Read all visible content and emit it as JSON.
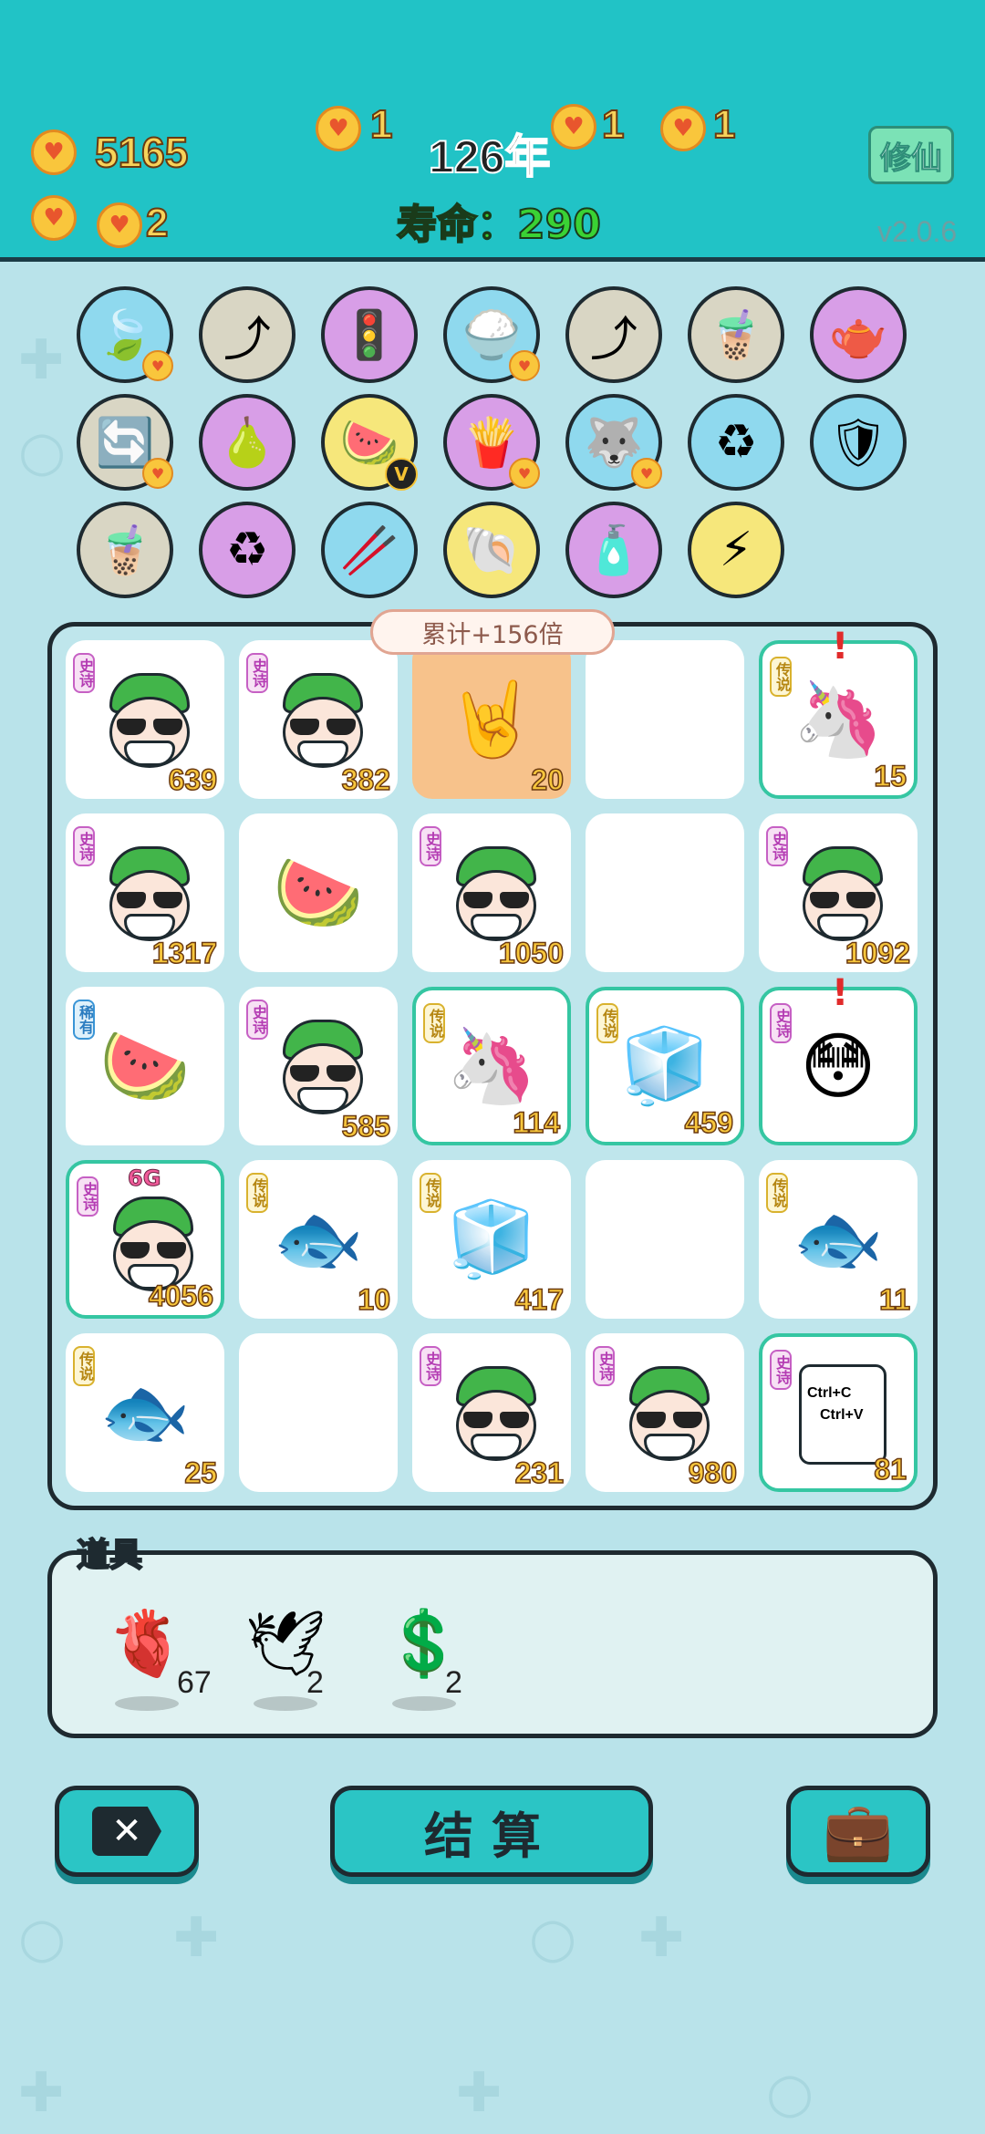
{
  "header": {
    "coins_total": "5165",
    "coin_small_a": "1",
    "coin_small_b": "1",
    "coin_small_c": "1",
    "coin_row2": "2",
    "year": "126年",
    "lifespan": "寿命：290",
    "cultivate_button": "修仙",
    "version": "v2.0.6"
  },
  "skills": [
    {
      "icon": "leaf-icon",
      "glyph": "🍃",
      "bg": "#8fd9ee",
      "badge": true
    },
    {
      "icon": "arrow-up-icon",
      "glyph": "⤴",
      "bg": "#d9d6c4",
      "badge": false
    },
    {
      "icon": "traffic-light-icon",
      "glyph": "🚦",
      "bg": "#d89ee7",
      "badge": false
    },
    {
      "icon": "rice-bowl-icon",
      "glyph": "🍚",
      "bg": "#8fd9ee",
      "badge": true
    },
    {
      "icon": "arrow-up-icon",
      "glyph": "⤴",
      "bg": "#d9d6c4",
      "badge": false
    },
    {
      "icon": "bubble-tea-icon",
      "glyph": "🧋",
      "bg": "#d9d6c4",
      "badge": false
    },
    {
      "icon": "gravy-boat-icon",
      "glyph": "🫖",
      "bg": "#d89ee7",
      "badge": false
    },
    {
      "icon": "refresh-icon",
      "glyph": "🔄",
      "bg": "#d9d6c4",
      "badge": true
    },
    {
      "icon": "grapefruit-icon",
      "glyph": "🍐",
      "bg": "#d89ee7",
      "badge": false
    },
    {
      "icon": "fruit-basket-icon",
      "glyph": "🍉",
      "bg": "#f6e77b",
      "badge": false,
      "vip": "V"
    },
    {
      "icon": "fries-icon",
      "glyph": "🍟",
      "bg": "#d89ee7",
      "badge": true
    },
    {
      "icon": "husky-icon",
      "glyph": "🐺",
      "bg": "#8fd9ee",
      "badge": true
    },
    {
      "icon": "recycle-bag-icon",
      "glyph": "♻",
      "bg": "#8fd9ee",
      "badge": false
    },
    {
      "icon": "shield-wrench-icon",
      "glyph": "🛡",
      "bg": "#8fd9ee",
      "badge": false
    },
    {
      "icon": "bubble-tea-icon",
      "glyph": "🧋",
      "bg": "#d9d6c4",
      "badge": false
    },
    {
      "icon": "recycle-icon",
      "glyph": "♻",
      "bg": "#d89ee7",
      "badge": false
    },
    {
      "icon": "chopsticks-icon",
      "glyph": "🥢",
      "bg": "#8fd9ee",
      "badge": false
    },
    {
      "icon": "shell-icon",
      "glyph": "🐚",
      "bg": "#f6e77b",
      "badge": false
    },
    {
      "icon": "perfume-icon",
      "glyph": "🧴",
      "bg": "#d89ee7",
      "badge": false
    },
    {
      "icon": "lightning-icon",
      "glyph": "⚡",
      "bg": "#f6e77b",
      "badge": false
    }
  ],
  "bubble": "累计+156倍",
  "board": [
    {
      "type": "man",
      "tag": "史诗",
      "tagClass": "epic",
      "count": "639"
    },
    {
      "type": "man",
      "tag": "史诗",
      "tagClass": "epic",
      "count": "382"
    },
    {
      "type": "hand",
      "icon": "rock-hand-icon",
      "glyph": "🤘",
      "count": "20",
      "orange": true
    },
    {
      "type": "empty"
    },
    {
      "type": "emoji",
      "icon": "unicorn-icon",
      "glyph": "🦄",
      "tag": "传说",
      "tagClass": "legend",
      "count": "15",
      "hl": true,
      "excl": "!"
    },
    {
      "type": "man",
      "tag": "史诗",
      "tagClass": "epic",
      "count": "1317"
    },
    {
      "type": "emoji",
      "icon": "watermelon-icon",
      "glyph": "🍉",
      "count": ""
    },
    {
      "type": "man",
      "tag": "史诗",
      "tagClass": "epic",
      "count": "1050"
    },
    {
      "type": "empty"
    },
    {
      "type": "man",
      "tag": "史诗",
      "tagClass": "epic",
      "count": "1092"
    },
    {
      "type": "emoji",
      "icon": "watermelon-icon",
      "glyph": "🍉",
      "tag": "稀有",
      "tagClass": "rare",
      "count": ""
    },
    {
      "type": "man",
      "tag": "史诗",
      "tagClass": "epic",
      "count": "585"
    },
    {
      "type": "emoji",
      "icon": "unicorn-crown-icon",
      "glyph": "🦄",
      "tag": "传说",
      "tagClass": "legend",
      "count": "114",
      "hl": true
    },
    {
      "type": "emoji",
      "icon": "fridge-icon",
      "glyph": "🧊",
      "tag": "传说",
      "tagClass": "legend",
      "count": "459",
      "hl": true
    },
    {
      "type": "emoji",
      "icon": "red-cap-boy-icon",
      "glyph": "😳",
      "tag": "史诗",
      "tagClass": "epic",
      "count": "",
      "hl": true,
      "excl": "!"
    },
    {
      "type": "man",
      "tag": "史诗",
      "tagClass": "epic",
      "count": "4056",
      "hl": true,
      "g": "6G"
    },
    {
      "type": "emoji",
      "icon": "koi-fish-icon",
      "glyph": "🐟",
      "tag": "传说",
      "tagClass": "legend",
      "count": "10"
    },
    {
      "type": "emoji",
      "icon": "fridge-icon",
      "glyph": "🧊",
      "tag": "传说",
      "tagClass": "legend",
      "count": "417"
    },
    {
      "type": "empty"
    },
    {
      "type": "emoji",
      "icon": "koi-fish-icon",
      "glyph": "🐟",
      "tag": "传说",
      "tagClass": "legend",
      "count": "11"
    },
    {
      "type": "emoji",
      "icon": "koi-fish-icon",
      "glyph": "🐟",
      "tag": "传说",
      "tagClass": "legend",
      "count": "25"
    },
    {
      "type": "empty"
    },
    {
      "type": "man",
      "tag": "史诗",
      "tagClass": "epic",
      "count": "231"
    },
    {
      "type": "man",
      "tag": "史诗",
      "tagClass": "epic",
      "count": "980"
    },
    {
      "type": "ctrl",
      "tag": "史诗",
      "tagClass": "epic",
      "count": "81",
      "hl": true,
      "line1": "Ctrl+C",
      "line2": "Ctrl+V"
    }
  ],
  "props": {
    "label": "道具",
    "items": [
      {
        "icon": "liver-icon",
        "glyph": "🫀",
        "count": "67"
      },
      {
        "icon": "white-bird-icon",
        "glyph": "🕊",
        "count": "2"
      },
      {
        "icon": "dollar-coin-icon",
        "glyph": "💲",
        "count": "2"
      }
    ]
  },
  "buttons": {
    "close_icon": "close-icon",
    "close_glyph": "✕",
    "settle": "结算",
    "bag_icon": "briefcase-icon",
    "bag_glyph": "💼"
  },
  "colors": {
    "header_bg": "#21c3c6",
    "page_bg": "#b9e3ea",
    "number_gold": "#f7c63c",
    "highlight_border": "#35c6a2"
  }
}
